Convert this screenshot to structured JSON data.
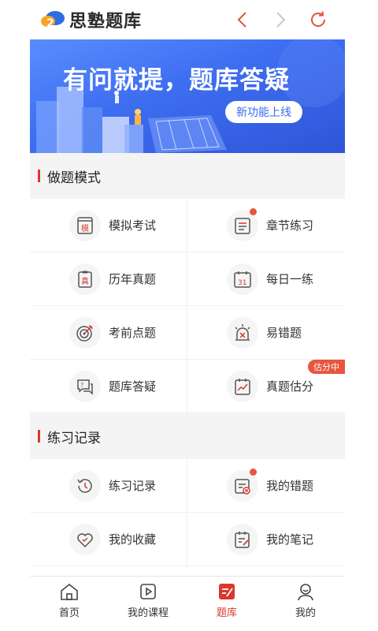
{
  "header": {
    "brand": "思塾题库",
    "back_icon": "chevron-left-icon",
    "forward_icon": "chevron-right-icon",
    "refresh_icon": "refresh-icon"
  },
  "banner": {
    "title": "有问就提，题库答疑",
    "badge": "新功能上线"
  },
  "practice_mode": {
    "title": "做题模式",
    "items": [
      {
        "label": "模拟考试",
        "icon": "mock-exam-icon",
        "icon_text": "模"
      },
      {
        "label": "章节练习",
        "icon": "chapter-list-icon",
        "dot": true
      },
      {
        "label": "历年真题",
        "icon": "past-paper-icon",
        "icon_text": "真"
      },
      {
        "label": "每日一练",
        "icon": "calendar-icon",
        "icon_text": "31"
      },
      {
        "label": "考前点题",
        "icon": "target-icon"
      },
      {
        "label": "易错题",
        "icon": "alarm-icon"
      },
      {
        "label": "题库答疑",
        "icon": "chat-question-icon"
      },
      {
        "label": "真题估分",
        "icon": "score-chart-icon",
        "tag": "估分中"
      }
    ]
  },
  "records": {
    "title": "练习记录",
    "items": [
      {
        "label": "练习记录",
        "icon": "history-clock-icon"
      },
      {
        "label": "我的错题",
        "icon": "wrong-questions-icon",
        "dot": true
      },
      {
        "label": "我的收藏",
        "icon": "heart-icon"
      },
      {
        "label": "我的笔记",
        "icon": "notes-icon"
      }
    ]
  },
  "tabbar": {
    "items": [
      {
        "label": "首页",
        "icon": "home-icon",
        "active": false
      },
      {
        "label": "我的课程",
        "icon": "play-course-icon",
        "active": false
      },
      {
        "label": "题库",
        "icon": "question-bank-icon",
        "active": true
      },
      {
        "label": "我的",
        "icon": "user-icon",
        "active": false
      }
    ]
  },
  "colors": {
    "accent": "#d9382c",
    "badge_red": "#e8553f",
    "banner_blue": "#3d6df0"
  }
}
